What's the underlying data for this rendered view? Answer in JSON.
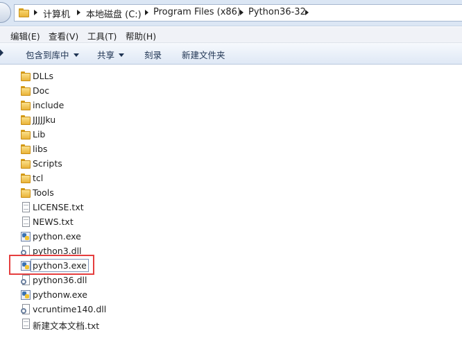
{
  "address_bar": {
    "breadcrumbs": [
      "计算机",
      "本地磁盘 (C:)",
      "Program Files (x86)",
      "Python36-32"
    ]
  },
  "menu": {
    "items": [
      "编辑(E)",
      "查看(V)",
      "工具(T)",
      "帮助(H)"
    ]
  },
  "toolbar": {
    "include_library": "包含到库中",
    "share": "共享",
    "burn": "刻录",
    "new_folder": "新建文件夹"
  },
  "files": [
    {
      "name": "DLLs",
      "icon": "folder-icon"
    },
    {
      "name": "Doc",
      "icon": "folder-icon"
    },
    {
      "name": "include",
      "icon": "folder-icon"
    },
    {
      "name": "JJJJJku",
      "icon": "folder-icon"
    },
    {
      "name": "Lib",
      "icon": "folder-icon"
    },
    {
      "name": "libs",
      "icon": "folder-icon"
    },
    {
      "name": "Scripts",
      "icon": "folder-icon"
    },
    {
      "name": "tcl",
      "icon": "folder-icon"
    },
    {
      "name": "Tools",
      "icon": "folder-icon"
    },
    {
      "name": "LICENSE.txt",
      "icon": "text-file-icon"
    },
    {
      "name": "NEWS.txt",
      "icon": "text-file-icon"
    },
    {
      "name": "python.exe",
      "icon": "python-exe-icon"
    },
    {
      "name": "python3.dll",
      "icon": "dll-file-icon"
    },
    {
      "name": "python3.exe",
      "icon": "python-exe-icon",
      "highlighted": true
    },
    {
      "name": "python36.dll",
      "icon": "dll-file-icon"
    },
    {
      "name": "pythonw.exe",
      "icon": "python-exe-icon"
    },
    {
      "name": "vcruntime140.dll",
      "icon": "dll-file-icon"
    },
    {
      "name": "新建文本文档.txt",
      "icon": "text-file-icon"
    }
  ],
  "colors": {
    "highlight_box": "#e53e3e",
    "address_bar_bg": "#dbe6f4",
    "toolbar_text": "#1e3352"
  }
}
